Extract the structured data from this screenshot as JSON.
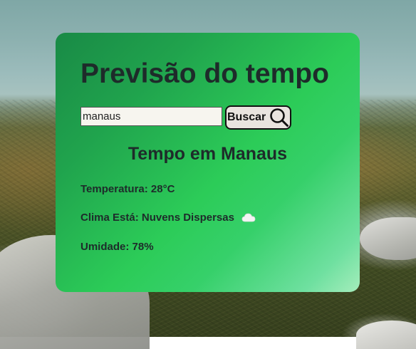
{
  "header": {
    "title": "Previsão do tempo"
  },
  "search": {
    "value": "manaus",
    "button_label": "Buscar"
  },
  "weather": {
    "city_title": "Tempo em Manaus",
    "temperature_label": "Temperatura:",
    "temperature_value": "28°C",
    "condition_label": "Clima Está:",
    "condition_value": "Nuvens Dispersas",
    "humidity_label": "Umidade:",
    "humidity_value": "78%"
  },
  "icons": {
    "search": "magnifier-icon",
    "condition": "cloud-icon"
  },
  "colors": {
    "card_gradient_start": "#198a46",
    "card_gradient_mid": "#2ccc58",
    "card_gradient_end": "#a5edbc",
    "text": "#1e2b2a",
    "button_bg": "#e9e4df"
  }
}
